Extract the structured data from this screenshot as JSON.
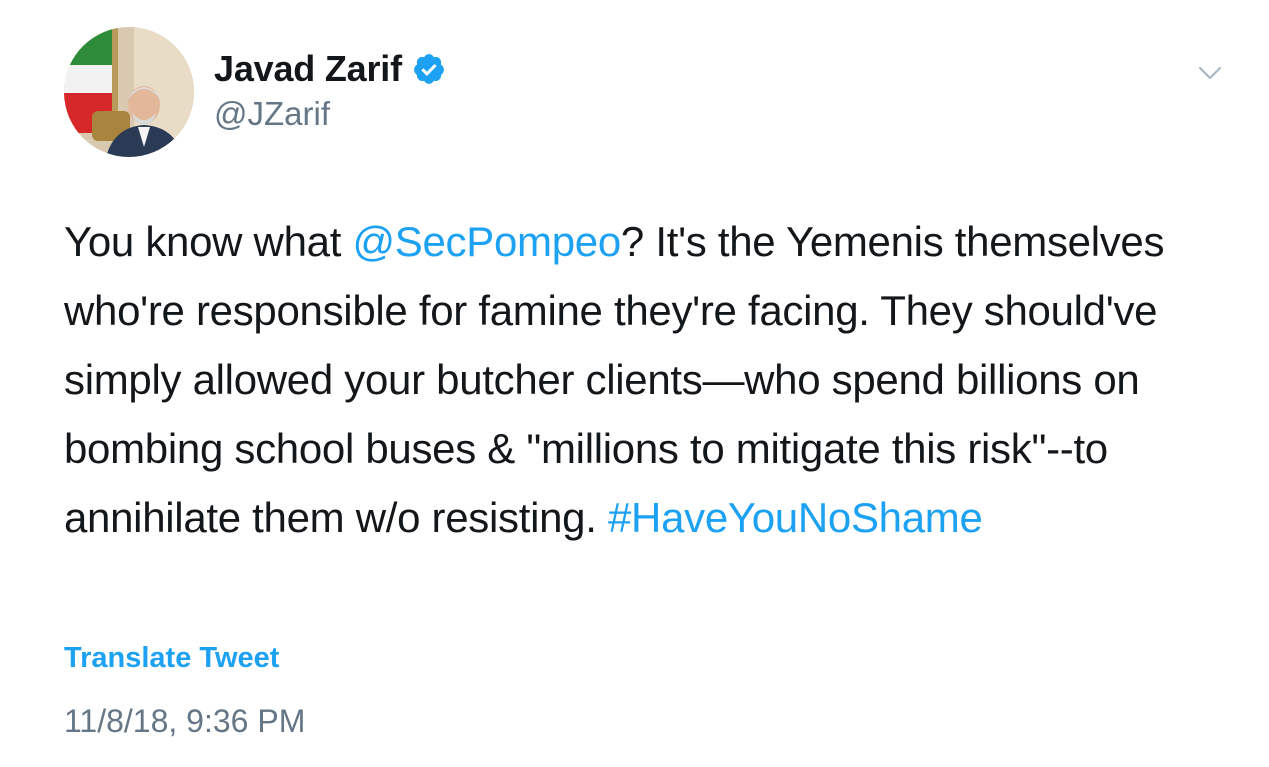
{
  "author": {
    "display_name": "Javad Zarif",
    "handle": "@JZarif",
    "verified": true
  },
  "tweet": {
    "segments": [
      {
        "text": "You know what ",
        "type": "text"
      },
      {
        "text": "@SecPompeo",
        "type": "mention"
      },
      {
        "text": "? It's the Yemenis themselves who're responsible for famine they're facing. They should've simply allowed your butcher clients—who spend billions on bombing school buses & \"millions to mitigate this risk\"--to annihilate them w/o resisting. ",
        "type": "text"
      },
      {
        "text": "#HaveYouNoShame",
        "type": "hashtag"
      }
    ],
    "translate_label": "Translate Tweet",
    "timestamp": "11/8/18, 9:36 PM"
  },
  "icons": {
    "verified": "verified-badge-icon",
    "menu": "chevron-down-icon"
  },
  "colors": {
    "accent": "#1da1f2",
    "text": "#14171a",
    "secondary": "#657786"
  }
}
